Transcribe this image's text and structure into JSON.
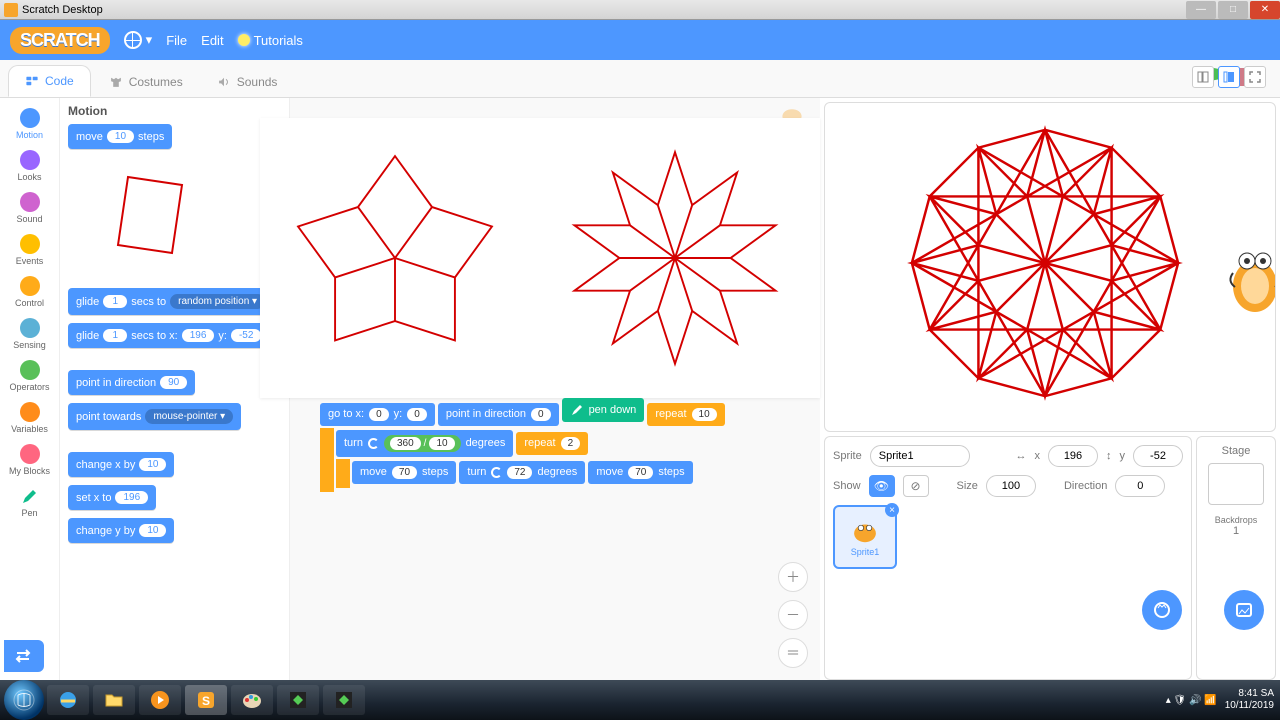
{
  "window": {
    "title": "Scratch Desktop"
  },
  "menubar": {
    "file": "File",
    "edit": "Edit",
    "tutorials": "Tutorials"
  },
  "tabs": {
    "code": "Code",
    "costumes": "Costumes",
    "sounds": "Sounds"
  },
  "categories": [
    {
      "label": "Motion",
      "color": "#4c97ff"
    },
    {
      "label": "Looks",
      "color": "#9966ff"
    },
    {
      "label": "Sound",
      "color": "#cf63cf"
    },
    {
      "label": "Events",
      "color": "#ffbf00"
    },
    {
      "label": "Control",
      "color": "#ffab19"
    },
    {
      "label": "Sensing",
      "color": "#5cb1d6"
    },
    {
      "label": "Operators",
      "color": "#59c059"
    },
    {
      "label": "Variables",
      "color": "#ff8c1a"
    },
    {
      "label": "My Blocks",
      "color": "#ff6680"
    },
    {
      "label": "Pen",
      "color": "#0fbd8c"
    }
  ],
  "palette": {
    "header": "Motion",
    "move": {
      "pre": "move",
      "val": "10",
      "post": "steps"
    },
    "glide1": {
      "pre": "glide",
      "secs": "1",
      "mid": "secs to",
      "target": "random position ▾"
    },
    "glide2": {
      "pre": "glide",
      "secs": "1",
      "mid": "secs to x:",
      "x": "196",
      "y_lbl": "y:",
      "y": "-52"
    },
    "point_dir": {
      "pre": "point in direction",
      "val": "90"
    },
    "point_tw": {
      "pre": "point towards",
      "target": "mouse-pointer ▾"
    },
    "change_x": {
      "pre": "change x by",
      "val": "10"
    },
    "set_x": {
      "pre": "set x to",
      "val": "196"
    },
    "change_y": {
      "pre": "change y by",
      "val": "10"
    }
  },
  "script": {
    "goto": {
      "pre": "go to x:",
      "x": "0",
      "ylbl": "y:",
      "y": "0"
    },
    "point": {
      "pre": "point in direction",
      "val": "0"
    },
    "pendown": "pen down",
    "repeat1": {
      "pre": "repeat",
      "val": "10"
    },
    "turn1": {
      "pre": "turn",
      "a": "360",
      "op": "/",
      "b": "10",
      "post": "degrees"
    },
    "repeat2": {
      "pre": "repeat",
      "val": "2"
    },
    "move1": {
      "pre": "move",
      "val": "70",
      "post": "steps"
    },
    "turn2": {
      "pre": "turn",
      "val": "72",
      "post": "degrees"
    },
    "move2": {
      "pre": "move",
      "val": "70",
      "post": "steps"
    }
  },
  "sprite_info": {
    "sprite_lbl": "Sprite",
    "name": "Sprite1",
    "x_lbl": "x",
    "x": "196",
    "y_lbl": "y",
    "y": "-52",
    "show_lbl": "Show",
    "size_lbl": "Size",
    "size": "100",
    "dir_lbl": "Direction",
    "dir": "0",
    "thumb_name": "Sprite1"
  },
  "stage_info": {
    "title": "Stage",
    "backdrops_lbl": "Backdrops",
    "backdrops": "1"
  },
  "taskbar": {
    "time": "8:41 SA",
    "date": "10/11/2019"
  }
}
